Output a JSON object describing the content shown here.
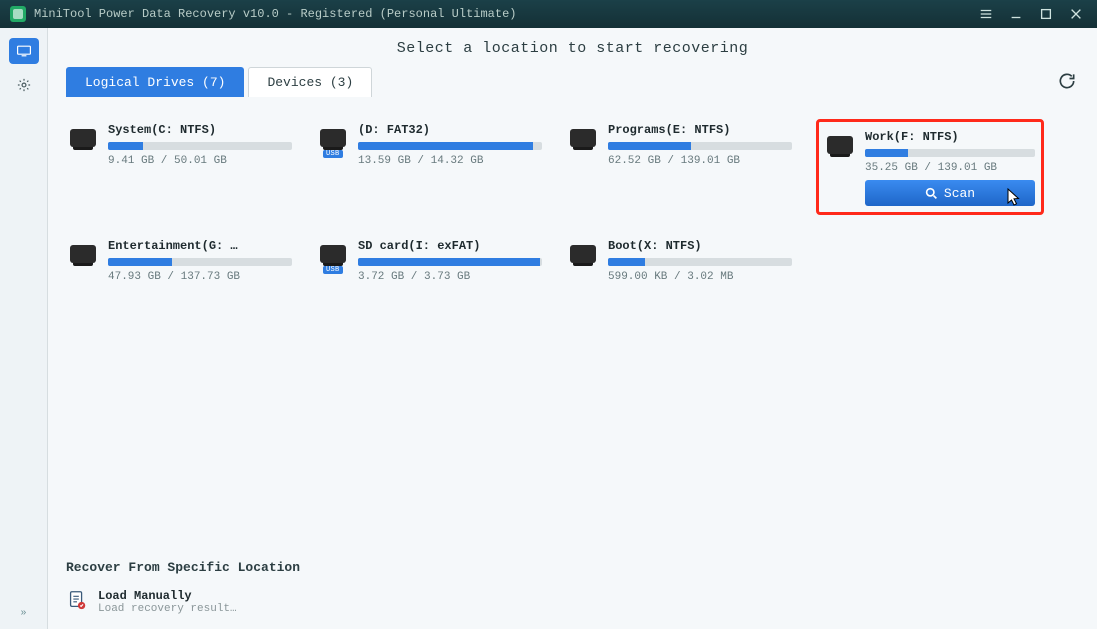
{
  "window_title": "MiniTool Power Data Recovery v10.0 - Registered (Personal Ultimate)",
  "heading": "Select a location to start recovering",
  "tabs": {
    "logical": "Logical Drives (7)",
    "devices": "Devices (3)"
  },
  "scan_label": "Scan",
  "drives": [
    {
      "name": "System(C: NTFS)",
      "used": "9.41 GB",
      "total": "50.01 GB",
      "pct": 19,
      "type": "hdd",
      "highlight": false
    },
    {
      "name": "(D: FAT32)",
      "used": "13.59 GB",
      "total": "14.32 GB",
      "pct": 95,
      "type": "usb",
      "highlight": false
    },
    {
      "name": "Programs(E: NTFS)",
      "used": "62.52 GB",
      "total": "139.01 GB",
      "pct": 45,
      "type": "hdd",
      "highlight": false
    },
    {
      "name": "Work(F: NTFS)",
      "used": "35.25 GB",
      "total": "139.01 GB",
      "pct": 25,
      "type": "hdd",
      "highlight": true
    },
    {
      "name": "Entertainment(G: …",
      "used": "47.93 GB",
      "total": "137.73 GB",
      "pct": 35,
      "type": "hdd",
      "highlight": false
    },
    {
      "name": "SD card(I: exFAT)",
      "used": "3.72 GB",
      "total": "3.73 GB",
      "pct": 99,
      "type": "usb",
      "highlight": false
    },
    {
      "name": "Boot(X: NTFS)",
      "used": "599.00 KB",
      "total": "3.02 MB",
      "pct": 20,
      "type": "hdd",
      "highlight": false
    }
  ],
  "recover_from": "Recover From Specific Location",
  "load_manually": {
    "title": "Load Manually",
    "subtitle": "Load recovery result…"
  },
  "icons": {
    "sidebar_recovery": "monitor-icon",
    "sidebar_settings": "gear-icon",
    "refresh": "refresh-icon",
    "usb_badge": "USB"
  }
}
